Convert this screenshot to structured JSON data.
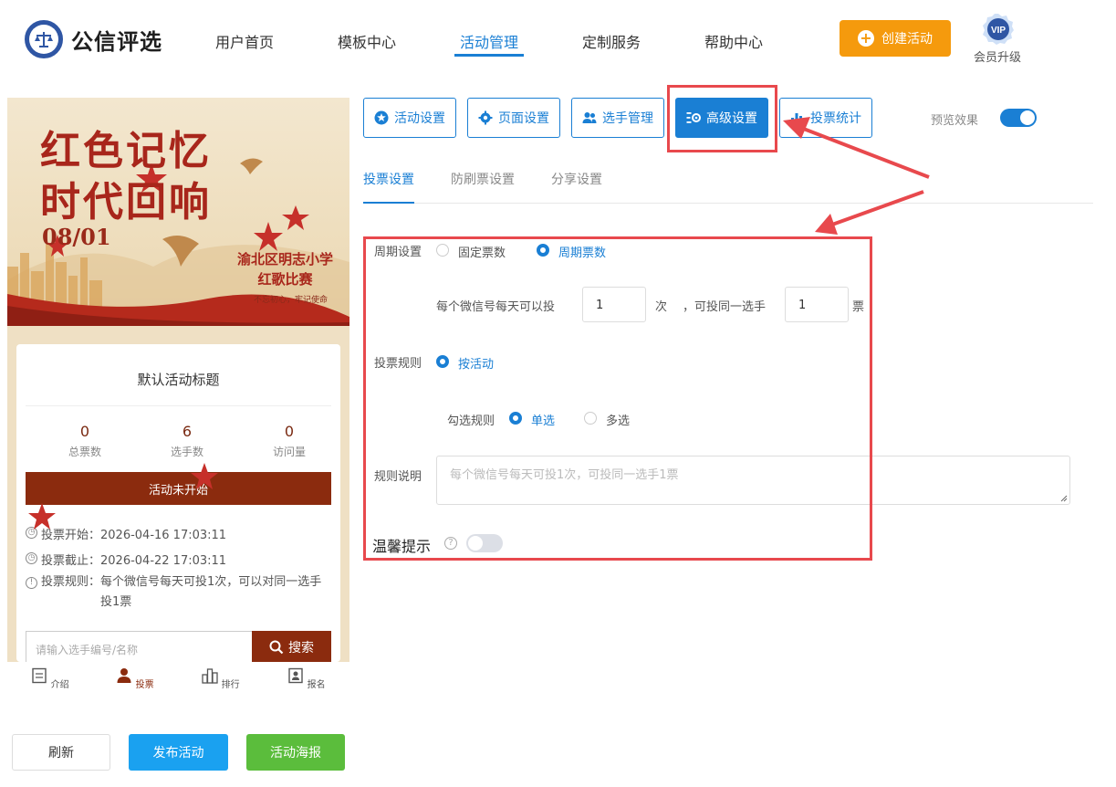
{
  "brand": {
    "name": "公信评选"
  },
  "nav": {
    "items": [
      "用户首页",
      "模板中心",
      "活动管理",
      "定制服务",
      "帮助中心"
    ],
    "active": "活动管理",
    "create_button": "创建活动",
    "vip_badge": "VIP",
    "vip_label": "会员升级"
  },
  "preview": {
    "banner": {
      "title_line1": "红色记忆",
      "title_line2": "时代回响",
      "date": "08/01",
      "school_line1": "渝北区明志小学",
      "school_line2": "红歌比赛",
      "motto": "不忘初心，牢记使命"
    },
    "card_title": "默认活动标题",
    "stats": [
      {
        "value": "0",
        "label": "总票数"
      },
      {
        "value": "6",
        "label": "选手数"
      },
      {
        "value": "0",
        "label": "访问量"
      }
    ],
    "status": "活动未开始",
    "vote_start": "投票开始：2026-04-16 17:03:11",
    "vote_end": "投票截止：2026-04-22 17:03:11",
    "vote_rule_line1": "投票规则：每个微信号每天可投1次，可以对同一选手",
    "vote_rule_line2": "投1票",
    "search_placeholder": "请输入选手编号/名称",
    "search_button": "搜索",
    "tabs": [
      "介绍",
      "投票",
      "排行",
      "报名"
    ],
    "active_tab": "投票"
  },
  "actions": {
    "refresh": "刷新",
    "publish": "发布活动",
    "poster": "活动海报"
  },
  "toolbar": {
    "buttons": [
      "活动设置",
      "页面设置",
      "选手管理",
      "高级设置",
      "投票统计"
    ],
    "active": "高级设置",
    "preview_label": "预览效果",
    "preview_on": true
  },
  "subtabs": {
    "items": [
      "投票设置",
      "防刷票设置",
      "分享设置"
    ],
    "active": "投票设置"
  },
  "form": {
    "cycle_label": "周期设置",
    "cycle_options": [
      "固定票数",
      "周期票数"
    ],
    "cycle_selected": "周期票数",
    "daily_prefix": "每个微信号每天可以投",
    "daily_value": "1",
    "daily_unit": "次",
    "same_prefix": "，可投同一选手",
    "same_value": "1",
    "same_unit": "票",
    "rule_label": "投票规则",
    "rule_option": "按活动",
    "check_label": "勾选规则",
    "check_options": [
      "单选",
      "多选"
    ],
    "check_selected": "单选",
    "desc_label": "规则说明",
    "desc_placeholder": "每个微信号每天可投1次，可投同一选手1票",
    "tip_label": "温馨提示",
    "tip_help": "?",
    "tip_enabled": false
  },
  "colors": {
    "primary": "#1a7fd4",
    "accent": "#f59a0d",
    "theme_red": "#8b2b0e",
    "highlight": "#e8494d",
    "publish": "#1aa1f0",
    "poster": "#5bbd3c"
  }
}
